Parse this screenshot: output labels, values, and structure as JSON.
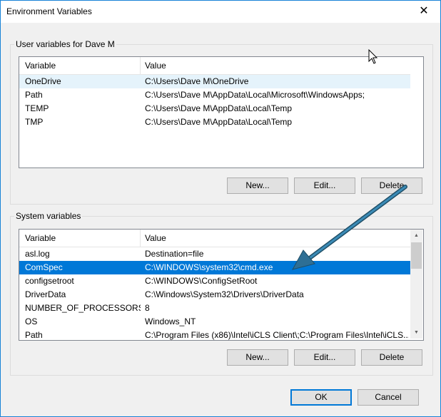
{
  "window": {
    "title": "Environment Variables",
    "close_glyph": "✕"
  },
  "user_vars": {
    "group_label": "User variables for Dave M",
    "columns": {
      "variable": "Variable",
      "value": "Value"
    },
    "rows": [
      {
        "variable": "OneDrive",
        "value": "C:\\Users\\Dave M\\OneDrive"
      },
      {
        "variable": "Path",
        "value": "C:\\Users\\Dave M\\AppData\\Local\\Microsoft\\WindowsApps;"
      },
      {
        "variable": "TEMP",
        "value": "C:\\Users\\Dave M\\AppData\\Local\\Temp"
      },
      {
        "variable": "TMP",
        "value": "C:\\Users\\Dave M\\AppData\\Local\\Temp"
      }
    ],
    "buttons": {
      "new": "New...",
      "edit": "Edit...",
      "delete": "Delete"
    }
  },
  "system_vars": {
    "group_label": "System variables",
    "columns": {
      "variable": "Variable",
      "value": "Value"
    },
    "rows": [
      {
        "variable": "asl.log",
        "value": "Destination=file"
      },
      {
        "variable": "ComSpec",
        "value": "C:\\WINDOWS\\system32\\cmd.exe"
      },
      {
        "variable": "configsetroot",
        "value": "C:\\WINDOWS\\ConfigSetRoot"
      },
      {
        "variable": "DriverData",
        "value": "C:\\Windows\\System32\\Drivers\\DriverData"
      },
      {
        "variable": "NUMBER_OF_PROCESSORS",
        "value": "8"
      },
      {
        "variable": "OS",
        "value": "Windows_NT"
      },
      {
        "variable": "Path",
        "value": "C:\\Program Files (x86)\\Intel\\iCLS Client\\;C:\\Program Files\\Intel\\iCLS..."
      }
    ],
    "buttons": {
      "new": "New...",
      "edit": "Edit...",
      "delete": "Delete"
    }
  },
  "footer": {
    "ok": "OK",
    "cancel": "Cancel"
  },
  "colors": {
    "selection": "#0078d7",
    "hover": "#e5f3fb",
    "annotation_arrow": "#2e6f95",
    "window_border": "#1883d7"
  },
  "icons": [
    "close-icon",
    "mouse-pointer-icon",
    "annotation-arrow-icon",
    "scroll-up-icon",
    "scroll-down-icon"
  ]
}
